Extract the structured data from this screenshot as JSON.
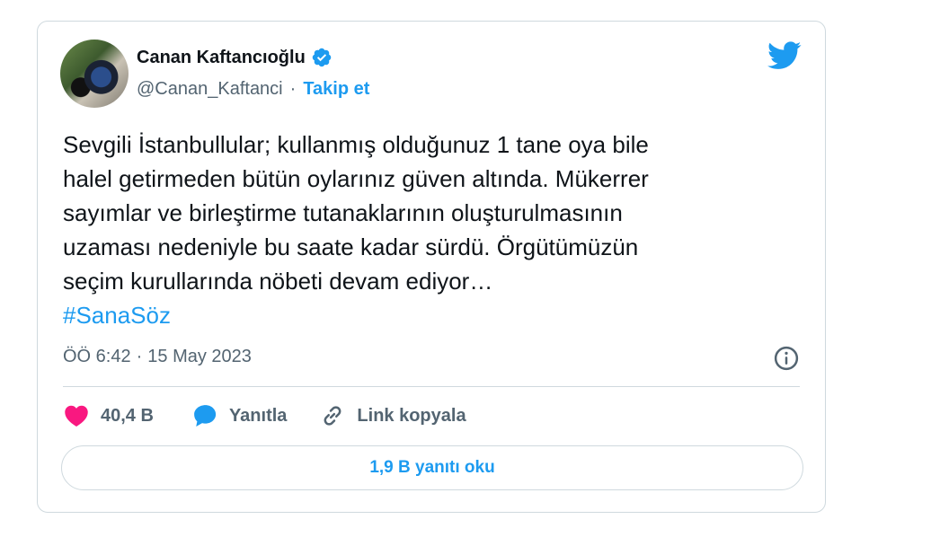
{
  "author": {
    "name": "Canan Kaftancıoğlu",
    "handle": "@Canan_Kaftanci",
    "separator": "·",
    "follow_label": "Takip et",
    "verified": true
  },
  "tweet": {
    "text": "Sevgili İstanbullular; kullanmış olduğunuz 1 tane oya bile\nhalel getirmeden bütün oylarınız güven altında. Mükerrer\nsayımlar ve birleştirme tutanaklarının oluşturulmasının\nuzaması nedeniyle bu saate kadar sürdü. Örgütümüzün\nseçim kurullarında nöbeti devam ediyor…",
    "hashtag": "#SanaSöz",
    "time": "ÖÖ 6:42",
    "date_separator": "·",
    "date": "15 May 2023"
  },
  "actions": {
    "likes": "40,4 B",
    "reply_label": "Yanıtla",
    "copy_link_label": "Link kopyala"
  },
  "read_replies_label": "1,9 B yanıtı oku",
  "colors": {
    "accent": "#1d9bf0",
    "like": "#f91880",
    "text": "#0f1419",
    "muted": "#536471",
    "border": "#cfd9de"
  },
  "icons": [
    "verified-badge-icon",
    "twitter-logo-icon",
    "info-icon",
    "heart-icon",
    "reply-bubble-icon",
    "link-icon"
  ]
}
